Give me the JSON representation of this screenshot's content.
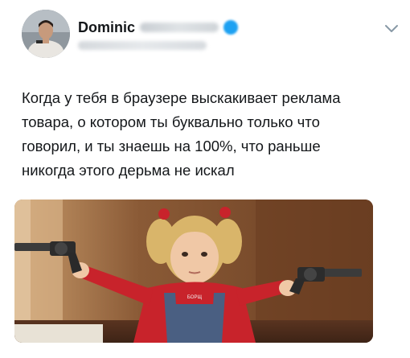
{
  "tweet": {
    "display_name": "Dominic",
    "text": "Когда у тебя в браузере выскакивает реклама\nтовара, о котором ты буквально только что\nговорил, и ты знаешь на 100%, что раньше\nникогда этого дерьма не искал",
    "dress_logo": "БОРЩ"
  },
  "icons": {
    "verified": "verified-badge-icon",
    "menu": "chevron-down-icon"
  },
  "colors": {
    "text": "#14171a",
    "verified": "#1da1f2",
    "shirt": "#c8232b",
    "overalls": "#4a5f82"
  }
}
